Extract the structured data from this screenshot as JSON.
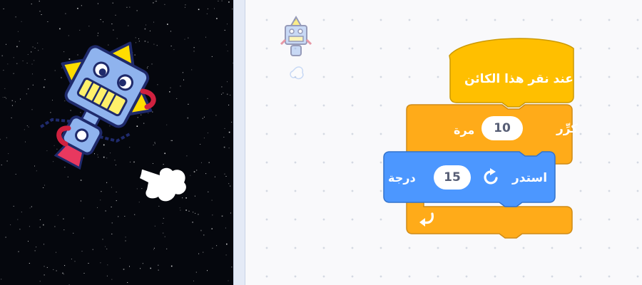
{
  "stage": {
    "background": "starfield",
    "sprite": "robot-sprite"
  },
  "workspace": {
    "thumbnail": "robot-sprite-thumbnail",
    "hat_block": {
      "label": "عند نقر هذا الكائن",
      "color": "#FFBF00"
    },
    "repeat_block": {
      "label": "كرِّر",
      "times": "10",
      "suffix": "مرة",
      "color": "#FFAB19",
      "loop_icon": "loop-arrow-icon"
    },
    "turn_block": {
      "label": "استدر",
      "degrees": "15",
      "suffix": "درجة",
      "color": "#4C97FF",
      "icon": "rotate-clockwise-icon"
    }
  }
}
